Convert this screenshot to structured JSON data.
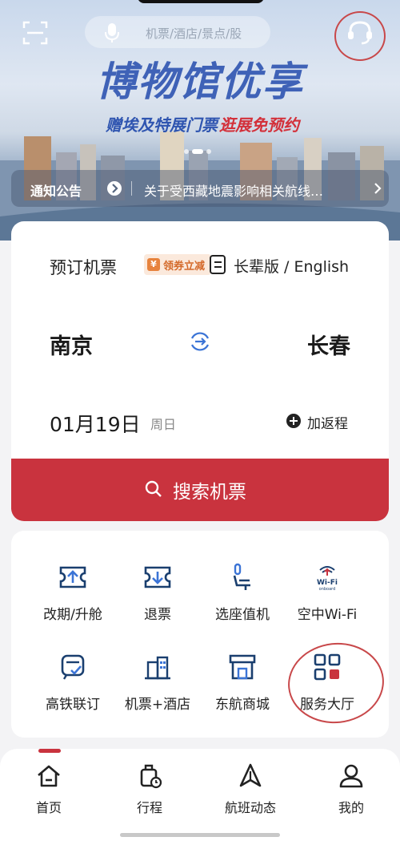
{
  "header": {
    "search_placeholder": "机票/酒店/景点/股"
  },
  "banner": {
    "title": "博物馆优享",
    "subtitle_blue": "赠埃及特展门票",
    "subtitle_red": "逛展免预约",
    "slide_count": 3,
    "active_slide": 1
  },
  "notice": {
    "label": "通知公告",
    "text": "关于受西藏地震影响相关航线…"
  },
  "booking": {
    "title": "预订机票",
    "coupon_label": "领券立减",
    "elder_label": "长辈版 / English",
    "from_city": "南京",
    "to_city": "长春",
    "date": "01月19日",
    "weekday": "周日",
    "return_label": "加返程",
    "search_label": "搜索机票"
  },
  "services": [
    {
      "label": "改期/升舱",
      "icon": "ticket-upgrade-icon"
    },
    {
      "label": "退票",
      "icon": "ticket-refund-icon"
    },
    {
      "label": "选座值机",
      "icon": "seat-icon"
    },
    {
      "label": "空中Wi-Fi",
      "icon": "wifi-onboard-icon"
    },
    {
      "label": "高铁联订",
      "icon": "train-icon"
    },
    {
      "label": "机票+酒店",
      "icon": "hotel-icon"
    },
    {
      "label": "东航商城",
      "icon": "shop-icon"
    },
    {
      "label": "服务大厅",
      "icon": "grid-icon"
    }
  ],
  "tabbar": {
    "items": [
      {
        "label": "首页",
        "icon": "home-icon"
      },
      {
        "label": "行程",
        "icon": "luggage-icon"
      },
      {
        "label": "航班动态",
        "icon": "plane-icon"
      },
      {
        "label": "我的",
        "icon": "user-icon"
      }
    ],
    "active_index": 0
  },
  "colors": {
    "brand_red": "#c9333e",
    "banner_blue": "#3f62b7",
    "coupon_orange": "#e7833d",
    "annotation_circle": "#c8484a"
  }
}
